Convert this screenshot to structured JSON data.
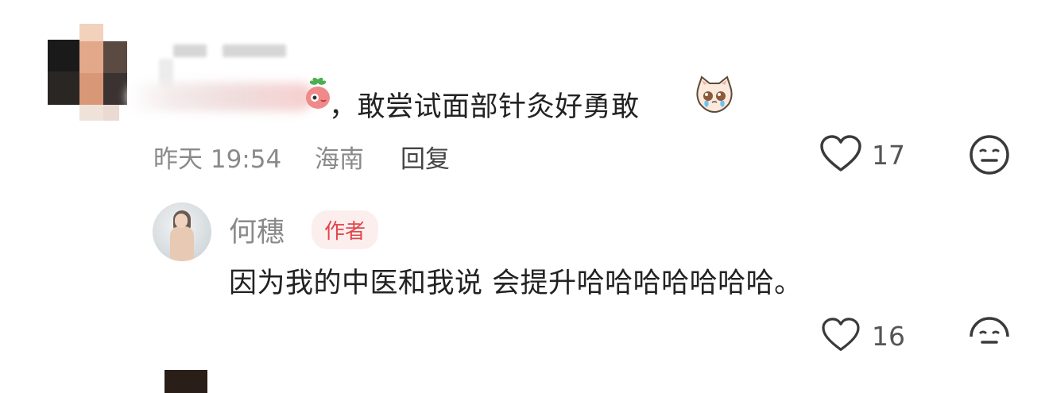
{
  "comment": {
    "text_suffix": "，敢尝试面部针灸好勇敢",
    "time": "昨天 19:54",
    "location": "海南",
    "reply_label": "回复",
    "like_count": "17"
  },
  "reply": {
    "author_name": "何穗",
    "author_badge": "作者",
    "text": "因为我的中医和我说 会提升哈哈哈哈哈哈哈。",
    "like_count": "16"
  },
  "icons": {
    "like": "heart-outline-icon",
    "dislike": "neutral-face-icon",
    "accent": "#e0464c"
  }
}
